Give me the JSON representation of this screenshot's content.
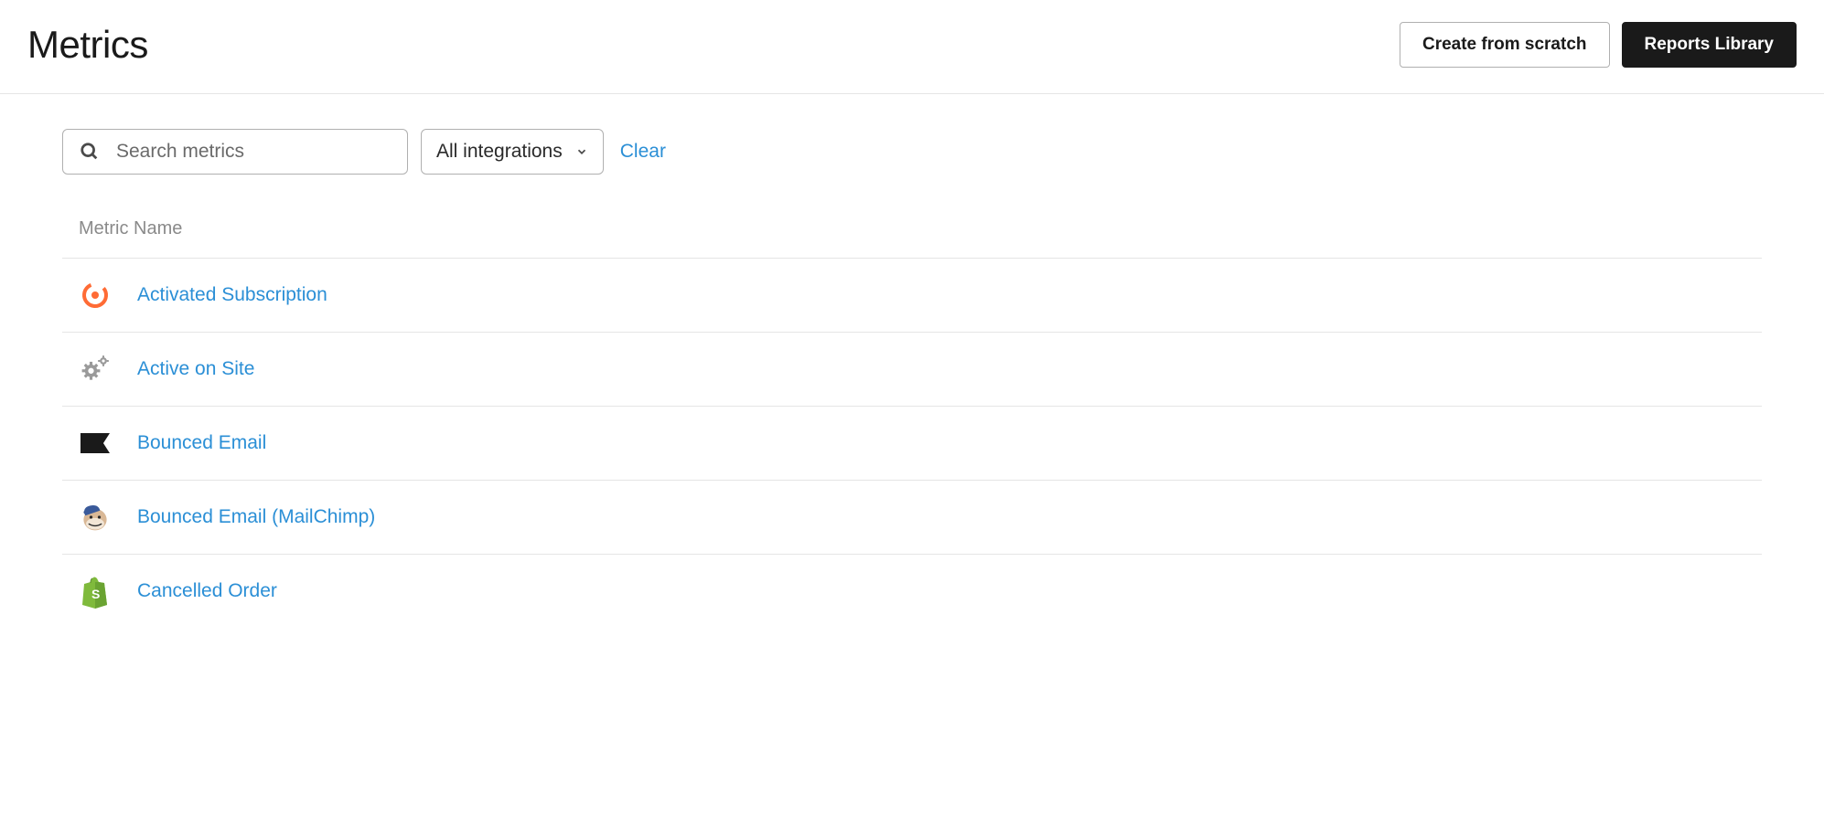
{
  "header": {
    "title": "Metrics",
    "create_button": "Create from scratch",
    "library_button": "Reports Library"
  },
  "filters": {
    "search_placeholder": "Search metrics",
    "integrations_label": "All integrations",
    "clear_label": "Clear"
  },
  "table": {
    "column_header": "Metric Name",
    "rows": [
      {
        "icon": "chargebee",
        "name": "Activated Subscription"
      },
      {
        "icon": "gears",
        "name": "Active on Site"
      },
      {
        "icon": "flag",
        "name": "Bounced Email"
      },
      {
        "icon": "mailchimp",
        "name": "Bounced Email (MailChimp)"
      },
      {
        "icon": "shopify",
        "name": "Cancelled Order"
      }
    ]
  },
  "colors": {
    "link": "#2b8fd6",
    "chargebee": "#ff6b35",
    "shopify": "#7fba3c"
  }
}
